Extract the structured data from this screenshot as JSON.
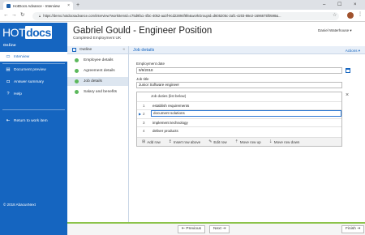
{
  "browser": {
    "tab_title": "HotDocs Advance - Interview",
    "tab_close": "×",
    "new_tab": "+",
    "url": "https://demo.hotdocsadvance.com/interview?workItemId=c75d9fa1-4f3c-4052-aa3f-9cd22894f8fe&workGroupId=d605205c-2af1-4203-88e2-1696675f0598&...",
    "controls": {
      "minimize": "–",
      "maximize": "☐",
      "close": "×"
    }
  },
  "sidebar": {
    "logo_hot": "HOT",
    "logo_docs": "docs",
    "logo_sub": "Online",
    "items": [
      {
        "label": "Interview",
        "icon": "monitor-icon"
      },
      {
        "label": "Document preview",
        "icon": "document-icon"
      },
      {
        "label": "Answer summary",
        "icon": "chat-icon"
      },
      {
        "label": "Help",
        "icon": "question-icon"
      },
      {
        "label": "Return to work item",
        "icon": "back-arrow-icon"
      }
    ],
    "copyright": "© 2018 AbacusNext"
  },
  "header": {
    "title": "Gabriel Gould - Engineer Position",
    "subtitle": "Completed Employment UK",
    "user": "Daniel Waterhouse"
  },
  "outline": {
    "heading": "Outline",
    "items": [
      {
        "label": "Employee details",
        "status": "complete"
      },
      {
        "label": "Agreement details",
        "status": "complete"
      },
      {
        "label": "Job details",
        "status": "complete"
      },
      {
        "label": "Salary and benefits",
        "status": "complete"
      }
    ],
    "selected_index": 2
  },
  "main": {
    "heading": "Job details",
    "actions": "Actions",
    "employment_date_label": "Employment date",
    "employment_date_value": "9/9/2018",
    "job_title_label": "Job title",
    "job_title_value": "Junior Software engineer",
    "duties": {
      "title": "Job duties (list below)",
      "rows": [
        {
          "num": "1",
          "text": "establish requirements"
        },
        {
          "num": "2",
          "text": "document solutions"
        },
        {
          "num": "3",
          "text": "implement technology"
        },
        {
          "num": "4",
          "text": "deliver products"
        }
      ],
      "active_row_index": 1,
      "toolbar": {
        "add_row": "Add row",
        "insert_row_above": "Insert row above",
        "edit_row": "Edit row",
        "move_row_up": "Move row up",
        "move_row_down": "Move row down"
      }
    }
  },
  "footer": {
    "previous": "Previous",
    "next": "Next",
    "finish": "Finish"
  },
  "colors": {
    "brand": "#1565c0",
    "complete": "#5cb85c",
    "progress": "#8bc34a"
  }
}
